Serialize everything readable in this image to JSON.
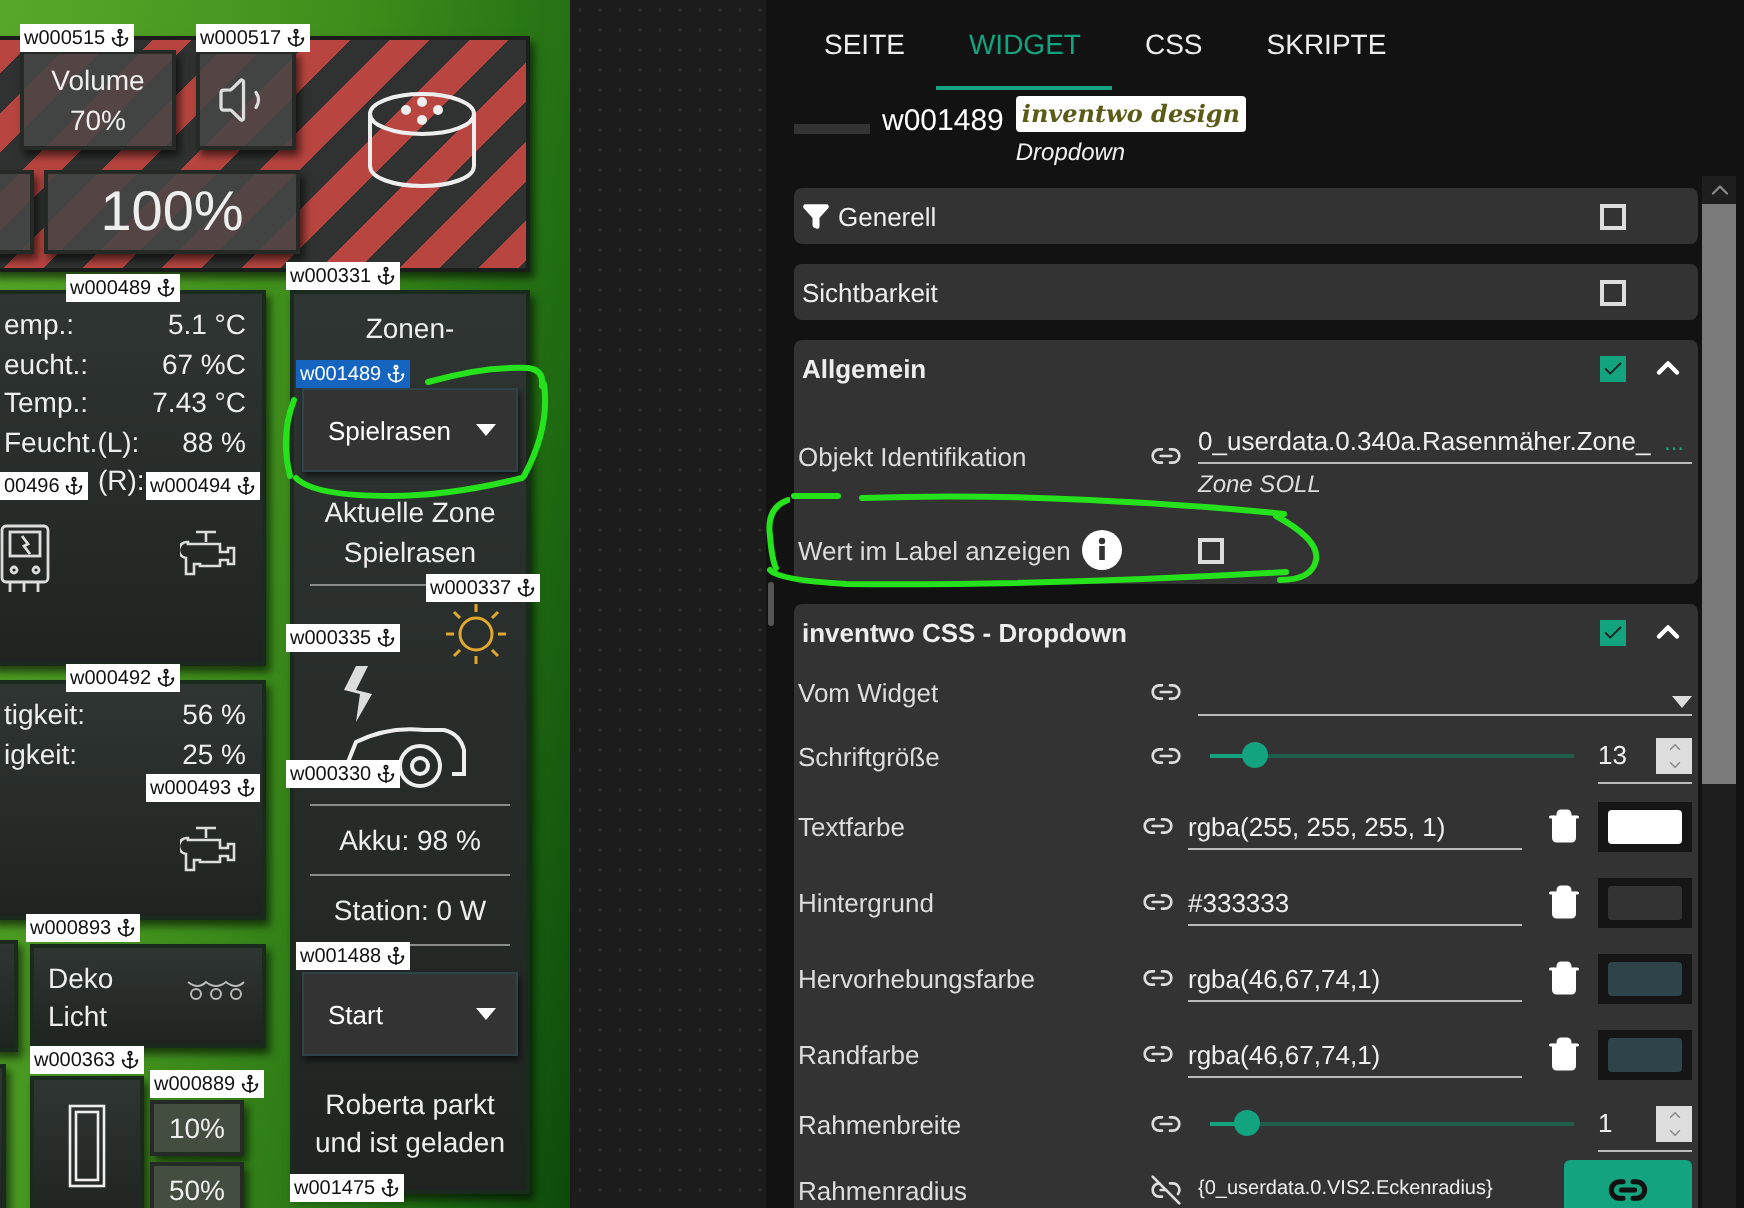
{
  "canvas": {
    "tags": [
      {
        "label": "w000515",
        "selected": false
      },
      {
        "label": "w000517",
        "selected": false
      },
      {
        "label": "w000489",
        "selected": false
      },
      {
        "label": "w000331",
        "selected": false
      },
      {
        "label": "w001489",
        "selected": true
      },
      {
        "label": "00496",
        "selected": false
      },
      {
        "label": "w000494",
        "selected": false
      },
      {
        "label": "w000337",
        "selected": false
      },
      {
        "label": "w000335",
        "selected": false
      },
      {
        "label": "w000330",
        "selected": false
      },
      {
        "label": "w000492",
        "selected": false
      },
      {
        "label": "w000493",
        "selected": false
      },
      {
        "label": "w000893",
        "selected": false
      },
      {
        "label": "w001488",
        "selected": false
      },
      {
        "label": "w000363",
        "selected": false
      },
      {
        "label": "w000889",
        "selected": false
      },
      {
        "label": "w001475",
        "selected": false
      }
    ],
    "speaker_panel": {
      "volume_button": "Volume 70%",
      "level_button": "100%"
    },
    "climate_panel": {
      "rows": [
        {
          "label": "emp.:",
          "value": "5.1 °C"
        },
        {
          "label": "eucht.:",
          "value": "67 %C"
        },
        {
          "label": "Temp.:",
          "value": "7.43 °C"
        },
        {
          "label": "Feucht.(L):",
          "value": "88 %"
        },
        {
          "label": "(R):"
        }
      ]
    },
    "moisture_panel": {
      "rows": [
        {
          "label": "tigkeit:",
          "value": "56 %"
        },
        {
          "label": "igkeit:",
          "value": "25 %"
        }
      ]
    },
    "light_tile": {
      "label": "Deko Licht"
    },
    "shutter_buttons": [
      "10%",
      "50%"
    ],
    "zone_panel": {
      "title": "Zonen-",
      "zone_select": "Spielrasen",
      "current_zone": "Aktuelle Zone Spielrasen",
      "battery": "Akku: 98 %",
      "station": "Station: 0 W",
      "action_select": "Start",
      "status": "Roberta parkt und ist geladen"
    }
  },
  "inspector": {
    "tabs": [
      {
        "label": "SEITE",
        "selected": false
      },
      {
        "label": "WIDGET",
        "selected": true
      },
      {
        "label": "CSS",
        "selected": false
      },
      {
        "label": "SKRIPTE",
        "selected": false
      }
    ],
    "widget": {
      "id": "w001489",
      "set": "inventwo design",
      "type": "Dropdown"
    },
    "sections": [
      {
        "title": "Generell",
        "checked": false,
        "expanded": false
      },
      {
        "title": "Sichtbarkeit",
        "checked": false,
        "expanded": false
      },
      {
        "title": "Allgemein",
        "checked": true,
        "expanded": true,
        "fields": [
          {
            "kind": "object",
            "label": "Objekt Identifikation",
            "value": "0_userdata.0.340a.Rasenmäher.Zone_",
            "button": "...",
            "hint": "Zone SOLL"
          },
          {
            "kind": "checkbox",
            "label": "Wert im Label anzeigen",
            "checked": false
          }
        ]
      },
      {
        "title": "inventwo CSS - Dropdown",
        "checked": true,
        "expanded": true,
        "fields": [
          {
            "kind": "select",
            "label": "Vom Widget"
          },
          {
            "kind": "slider",
            "label": "Schriftgröße",
            "level": 0.12,
            "value": "13"
          },
          {
            "kind": "color",
            "label": "Textfarbe",
            "value": "rgba(255, 255, 255, 1)",
            "color": "#ffffff"
          },
          {
            "kind": "color",
            "label": "Hintergrund",
            "value": "#333333",
            "color": "#333333"
          },
          {
            "kind": "color",
            "label": "Hervorhebungsfarbe",
            "value": "rgba(46,67,74,1)",
            "color": "#2e434a"
          },
          {
            "kind": "color",
            "label": "Randfarbe",
            "value": "rgba(46,67,74,1)",
            "color": "#2e434a"
          },
          {
            "kind": "slider",
            "label": "Rahmenbreite",
            "level": 0.1,
            "value": "1"
          },
          {
            "kind": "binding",
            "label": "Rahmenradius",
            "value": "{0_userdata.0.VIS2.Eckenradius}"
          }
        ]
      }
    ]
  }
}
